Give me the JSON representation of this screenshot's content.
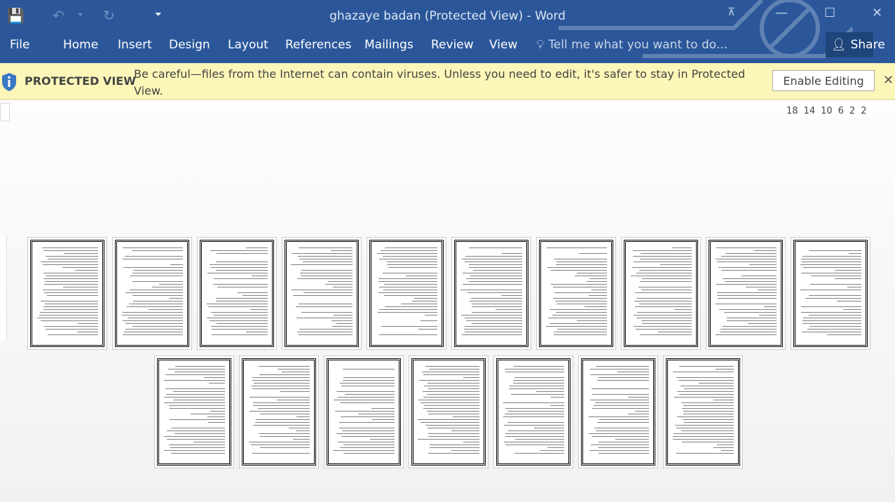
{
  "window": {
    "title": "ghazaye badan (Protected View) - Word"
  },
  "ribbon": {
    "tabs": [
      "File",
      "Home",
      "Insert",
      "Design",
      "Layout",
      "References",
      "Mailings",
      "Review",
      "View"
    ],
    "tell_me": "Tell me what you want to do...",
    "share": "Share"
  },
  "protected_view": {
    "label": "PROTECTED VIEW",
    "message": "Be careful—files from the Internet can contain viruses. Unless you need to edit, it's safer to stay in Protected View.",
    "enable_button": "Enable Editing"
  },
  "ruler": {
    "ticks": [
      "18",
      "14",
      "10",
      "6",
      "2",
      "2"
    ]
  },
  "colors": {
    "ribbon": "#2b579a",
    "banner": "#fcf6b8"
  },
  "pages": {
    "row1_count": 10,
    "row2_count": 7
  }
}
